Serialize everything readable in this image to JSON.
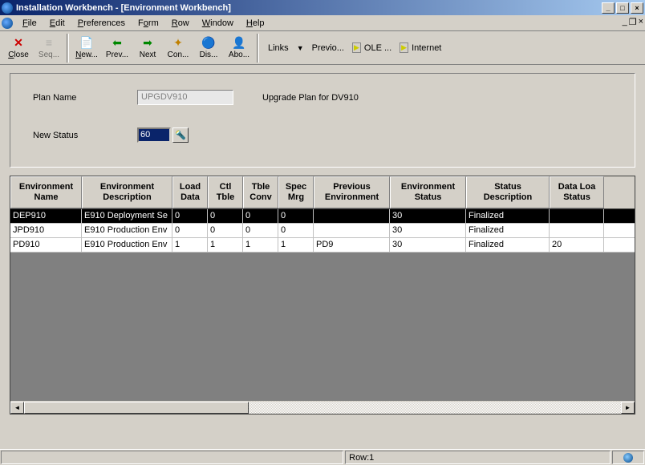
{
  "window": {
    "title": "Installation Workbench - [Environment Workbench]"
  },
  "menu": {
    "file": "File",
    "edit": "Edit",
    "preferences": "Preferences",
    "form": "Form",
    "row": "Row",
    "window": "Window",
    "help": "Help"
  },
  "toolbar": {
    "close": "Close",
    "seq": "Seq...",
    "new": "New...",
    "prev": "Prev...",
    "next": "Next",
    "con": "Con...",
    "dis": "Dis...",
    "abo": "Abo...",
    "links": "Links",
    "previo": "Previo...",
    "ole": "OLE ...",
    "internet": "Internet"
  },
  "form": {
    "plan_name_label": "Plan Name",
    "plan_name_value": "UPGDV910",
    "plan_desc": "Upgrade Plan for DV910",
    "new_status_label": "New Status",
    "new_status_value": "60"
  },
  "grid": {
    "headers": {
      "env_name": "Environment Name",
      "env_desc": "Environment Description",
      "load_data": "Load Data",
      "ctl_tble": "Ctl Tble",
      "tble_conv": "Tble Conv",
      "spec_mrg": "Spec Mrg",
      "prev_env": "Previous Environment",
      "env_status": "Environment Status",
      "status_desc": "Status Description",
      "data_load_status": "Data Loa Status"
    },
    "rows": [
      {
        "env": "DEP910",
        "desc": "E910 Deployment Se",
        "load": "0",
        "ctl": "0",
        "tble": "0",
        "spec": "0",
        "prev": "",
        "status": "30",
        "sdesc": "Finalized",
        "dls": ""
      },
      {
        "env": "JPD910",
        "desc": "E910 Production Env",
        "load": "0",
        "ctl": "0",
        "tble": "0",
        "spec": "0",
        "prev": "",
        "status": "30",
        "sdesc": "Finalized",
        "dls": ""
      },
      {
        "env": "PD910",
        "desc": "E910 Production Env",
        "load": "1",
        "ctl": "1",
        "tble": "1",
        "spec": "1",
        "prev": "PD9",
        "status": "30",
        "sdesc": "Finalized",
        "dls": "20"
      }
    ]
  },
  "statusbar": {
    "row": "Row:1"
  }
}
